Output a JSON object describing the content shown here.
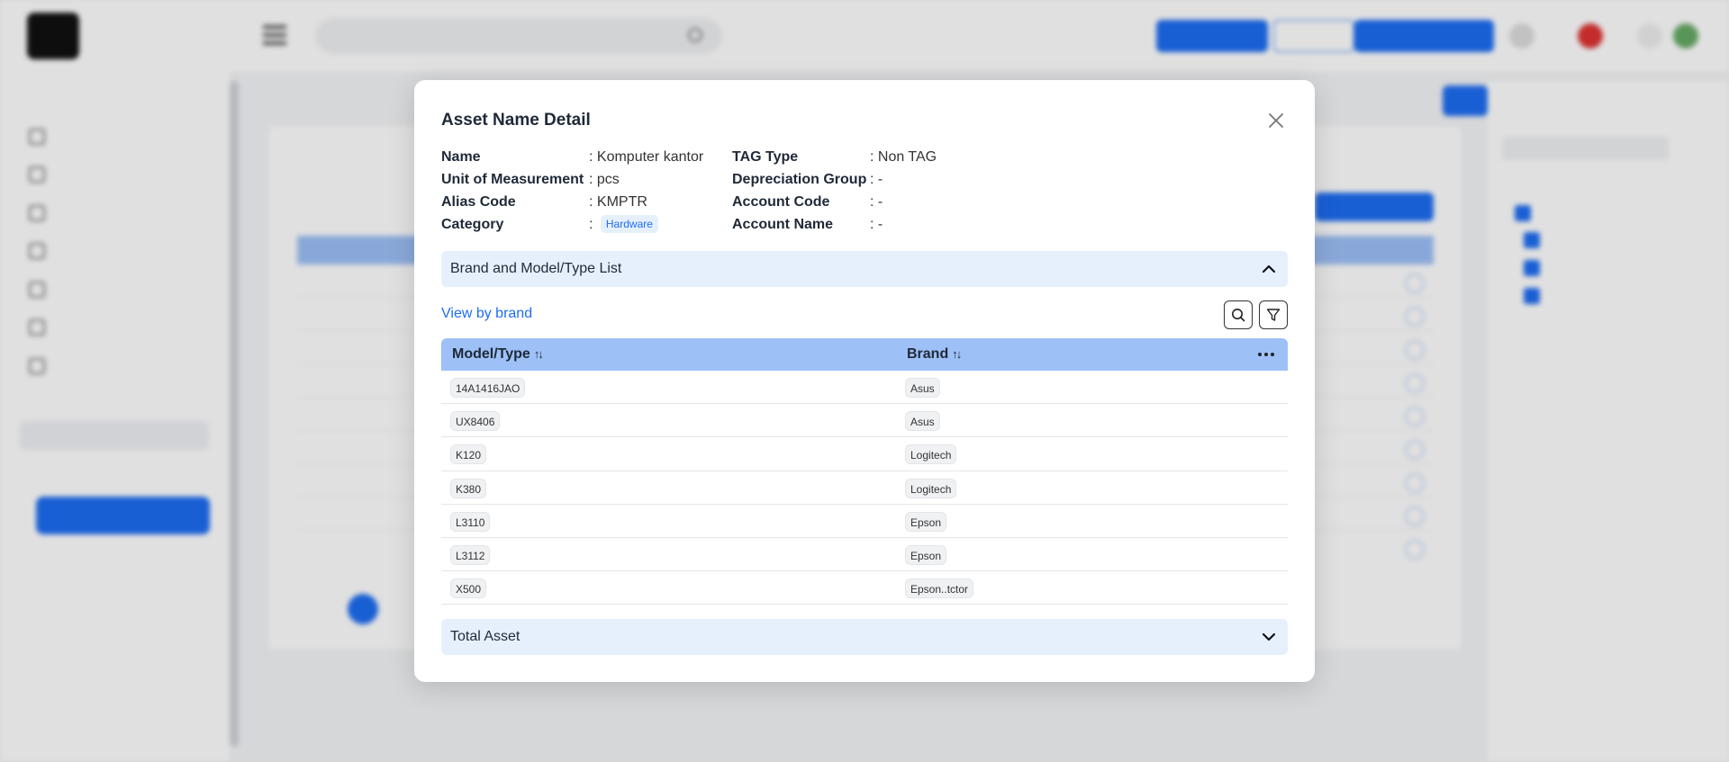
{
  "modal": {
    "title": "Asset Name Detail",
    "left_fields": [
      {
        "label": "Name",
        "value": "Komputer kantor"
      },
      {
        "label": "Unit of Measurement",
        "value": "pcs"
      },
      {
        "label": "Alias Code",
        "value": "KMPTR"
      },
      {
        "label": "Category",
        "value": "Hardware"
      }
    ],
    "right_fields": [
      {
        "label": "TAG Type",
        "value": "Non TAG"
      },
      {
        "label": "Depreciation Group",
        "value": "-"
      },
      {
        "label": "Account Code",
        "value": "-"
      },
      {
        "label": "Account Name",
        "value": "-"
      }
    ],
    "brand_section_label": "Brand and Model/Type List",
    "view_link": "View by brand",
    "table": {
      "headers": [
        "Model/Type",
        "Brand"
      ],
      "rows": [
        {
          "model": "14A1416JAO",
          "brand": "Asus"
        },
        {
          "model": "UX8406",
          "brand": "Asus"
        },
        {
          "model": "K120",
          "brand": "Logitech"
        },
        {
          "model": "K380",
          "brand": "Logitech"
        },
        {
          "model": "L3110",
          "brand": "Epson"
        },
        {
          "model": "L3112",
          "brand": "Epson"
        },
        {
          "model": "X500",
          "brand": "Epson..tctor"
        }
      ]
    },
    "total_section_label": "Total Asset"
  },
  "colors": {
    "primary": "#1d6df2",
    "table_header": "#9dc0f7",
    "accordion_bg": "#e6f0fd"
  }
}
